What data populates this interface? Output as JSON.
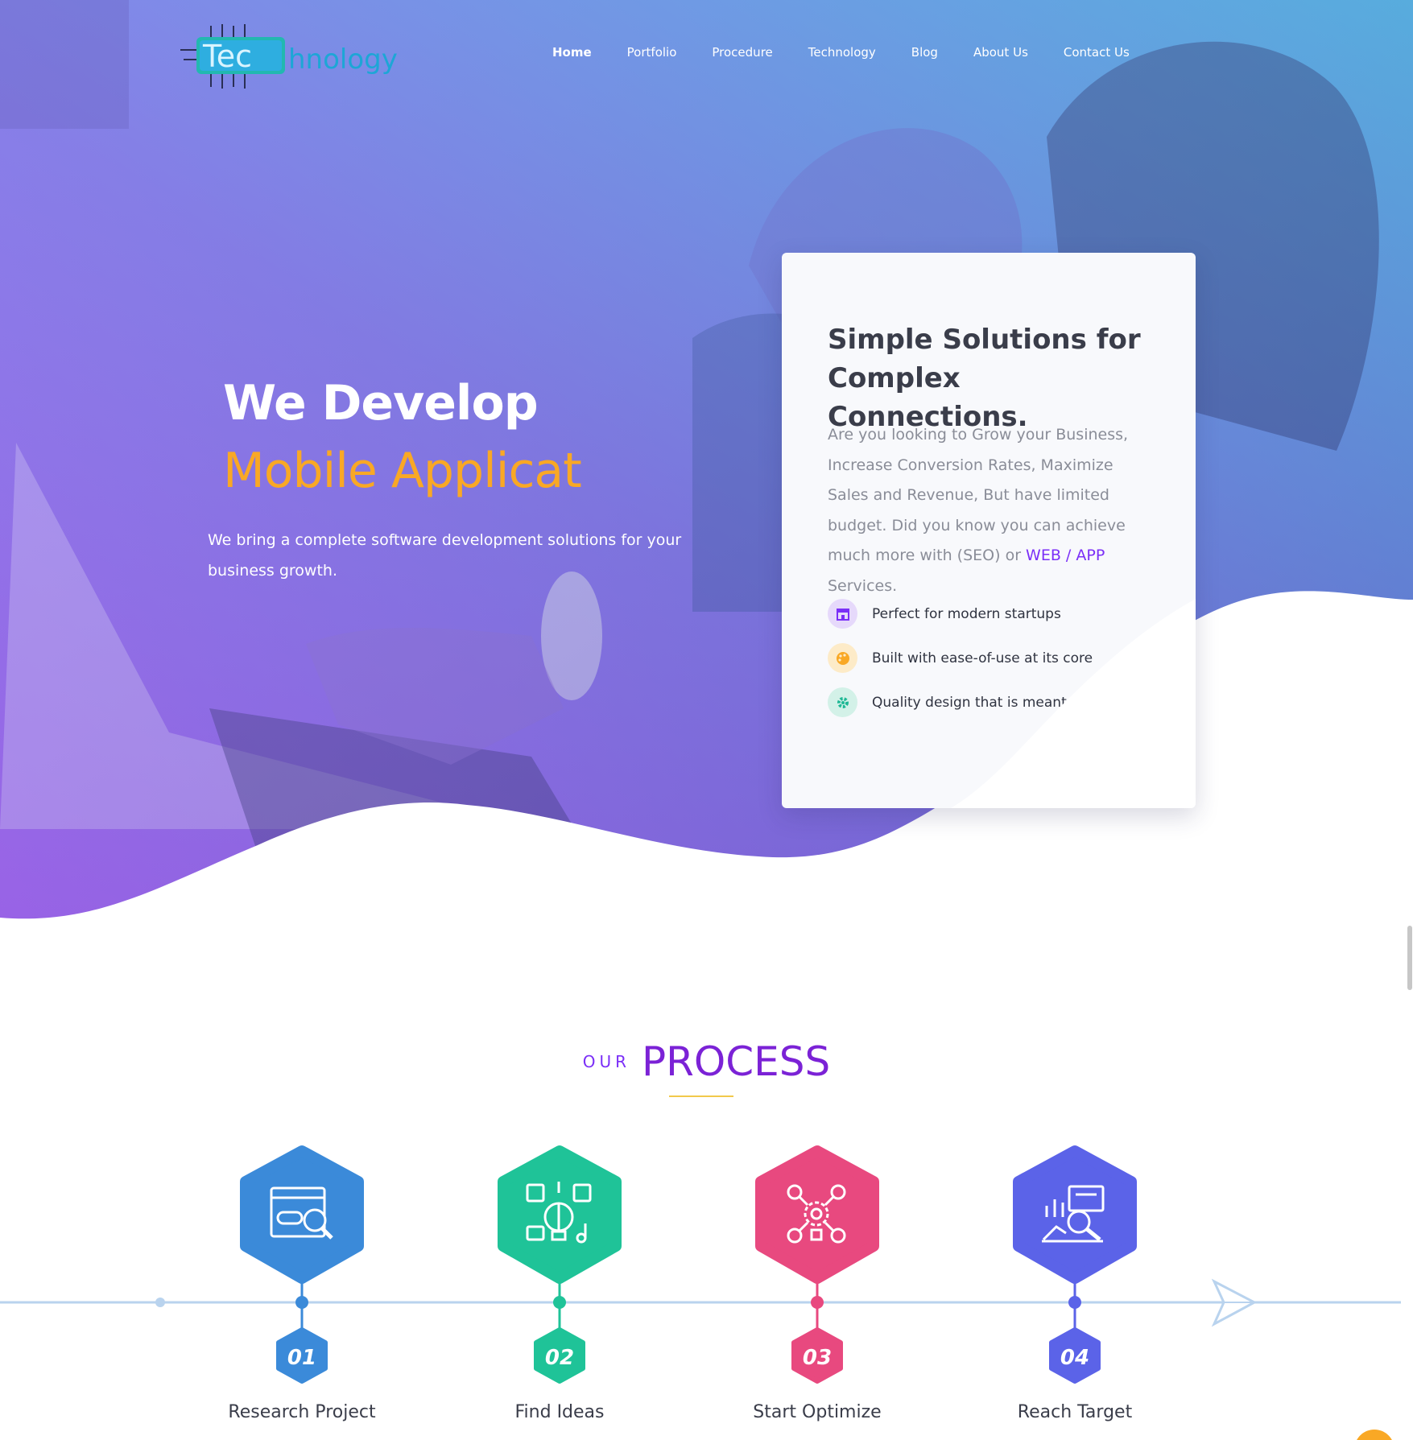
{
  "brand": {
    "logo_prefix": "Tec",
    "logo_suffix": "hnology"
  },
  "nav": {
    "items": [
      {
        "label": "Home",
        "active": true
      },
      {
        "label": "Portfolio",
        "active": false
      },
      {
        "label": "Procedure",
        "active": false
      },
      {
        "label": "Technology",
        "active": false
      },
      {
        "label": "Blog",
        "active": false
      },
      {
        "label": "About Us",
        "active": false
      },
      {
        "label": "Contact Us",
        "active": false
      }
    ]
  },
  "hero": {
    "title": "We Develop",
    "rotating_text": "Mobile Applicat",
    "subtitle": "We bring a complete software development solutions for your business growth."
  },
  "card": {
    "title_bold": "Simple",
    "title_rest": " Solutions for Complex Connections.",
    "text_before": "Are you looking to Grow your Business, Increase Conversion Rates, Maximize Sales and Revenue, But have limited budget. Did you know you can achieve much more with (SEO) or ",
    "text_web": "WEB",
    "text_slash": " / ",
    "text_app": "APP",
    "text_after": " Services.",
    "features": [
      {
        "label": "Perfect for modern startups",
        "icon": "store-icon",
        "color": "#7b2ff7",
        "bg": "#e6d9fb"
      },
      {
        "label": "Built with ease-of-use at its core",
        "icon": "palette-icon",
        "color": "#f9a825",
        "bg": "#fdebc8"
      },
      {
        "label": "Quality design that is meant to l",
        "icon": "gear-icon",
        "color": "#1fb895",
        "bg": "#d3f1e8"
      }
    ]
  },
  "process": {
    "our": "OUR",
    "word": "PROCESS",
    "steps": [
      {
        "number": "01",
        "label": "Research Project",
        "color": "#3b8ad9",
        "icon": "browser-search-icon"
      },
      {
        "number": "02",
        "label": "Find Ideas",
        "color": "#1fc398",
        "icon": "brain-ideas-icon"
      },
      {
        "number": "03",
        "label": "Start Optimize",
        "color": "#e8497f",
        "icon": "network-gear-icon"
      },
      {
        "number": "04",
        "label": "Reach Target",
        "color": "#5b63e8",
        "icon": "analytics-target-icon"
      }
    ]
  },
  "colors": {
    "accent_purple": "#7b2ff7",
    "accent_orange": "#f9a825",
    "timeline": "#b9d3ee"
  }
}
